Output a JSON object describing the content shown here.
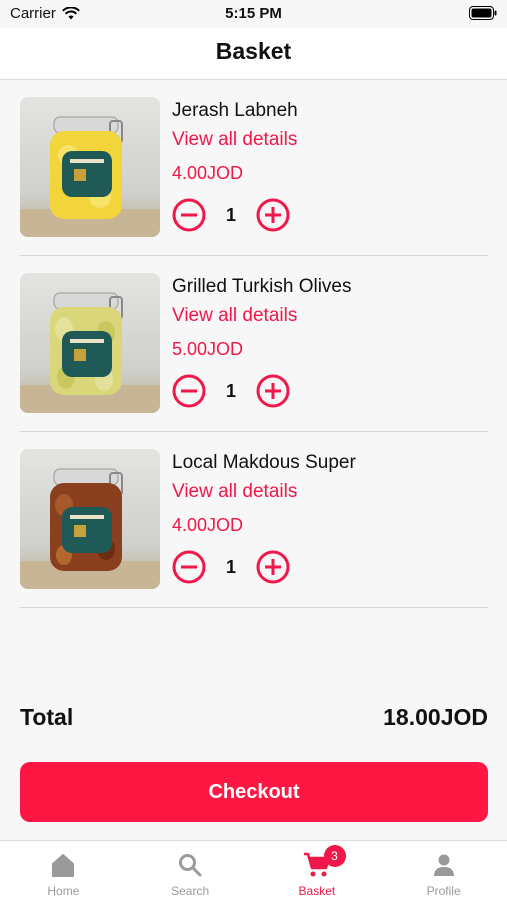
{
  "status_bar": {
    "carrier": "Carrier",
    "time": "5:15 PM"
  },
  "header": {
    "title": "Basket"
  },
  "items": [
    {
      "name": "Jerash Labneh",
      "link": "View all details",
      "price": "4.00JOD",
      "quantity": "1"
    },
    {
      "name": "Grilled Turkish Olives",
      "link": "View all details",
      "price": "5.00JOD",
      "quantity": "1"
    },
    {
      "name": "Local Makdous Super",
      "link": "View all details",
      "price": "4.00JOD",
      "quantity": "1"
    }
  ],
  "summary": {
    "total_label": "Total",
    "total_value": "18.00JOD"
  },
  "checkout": {
    "label": "Checkout"
  },
  "tabs": [
    {
      "label": "Home",
      "icon": "home-icon"
    },
    {
      "label": "Search",
      "icon": "search-icon"
    },
    {
      "label": "Basket",
      "icon": "cart-icon",
      "badge": "3",
      "active": true
    },
    {
      "label": "Profile",
      "icon": "profile-icon"
    }
  ],
  "colors": {
    "accent": "#f0184a",
    "button": "#ff1744",
    "background": "#f7f7f7"
  }
}
